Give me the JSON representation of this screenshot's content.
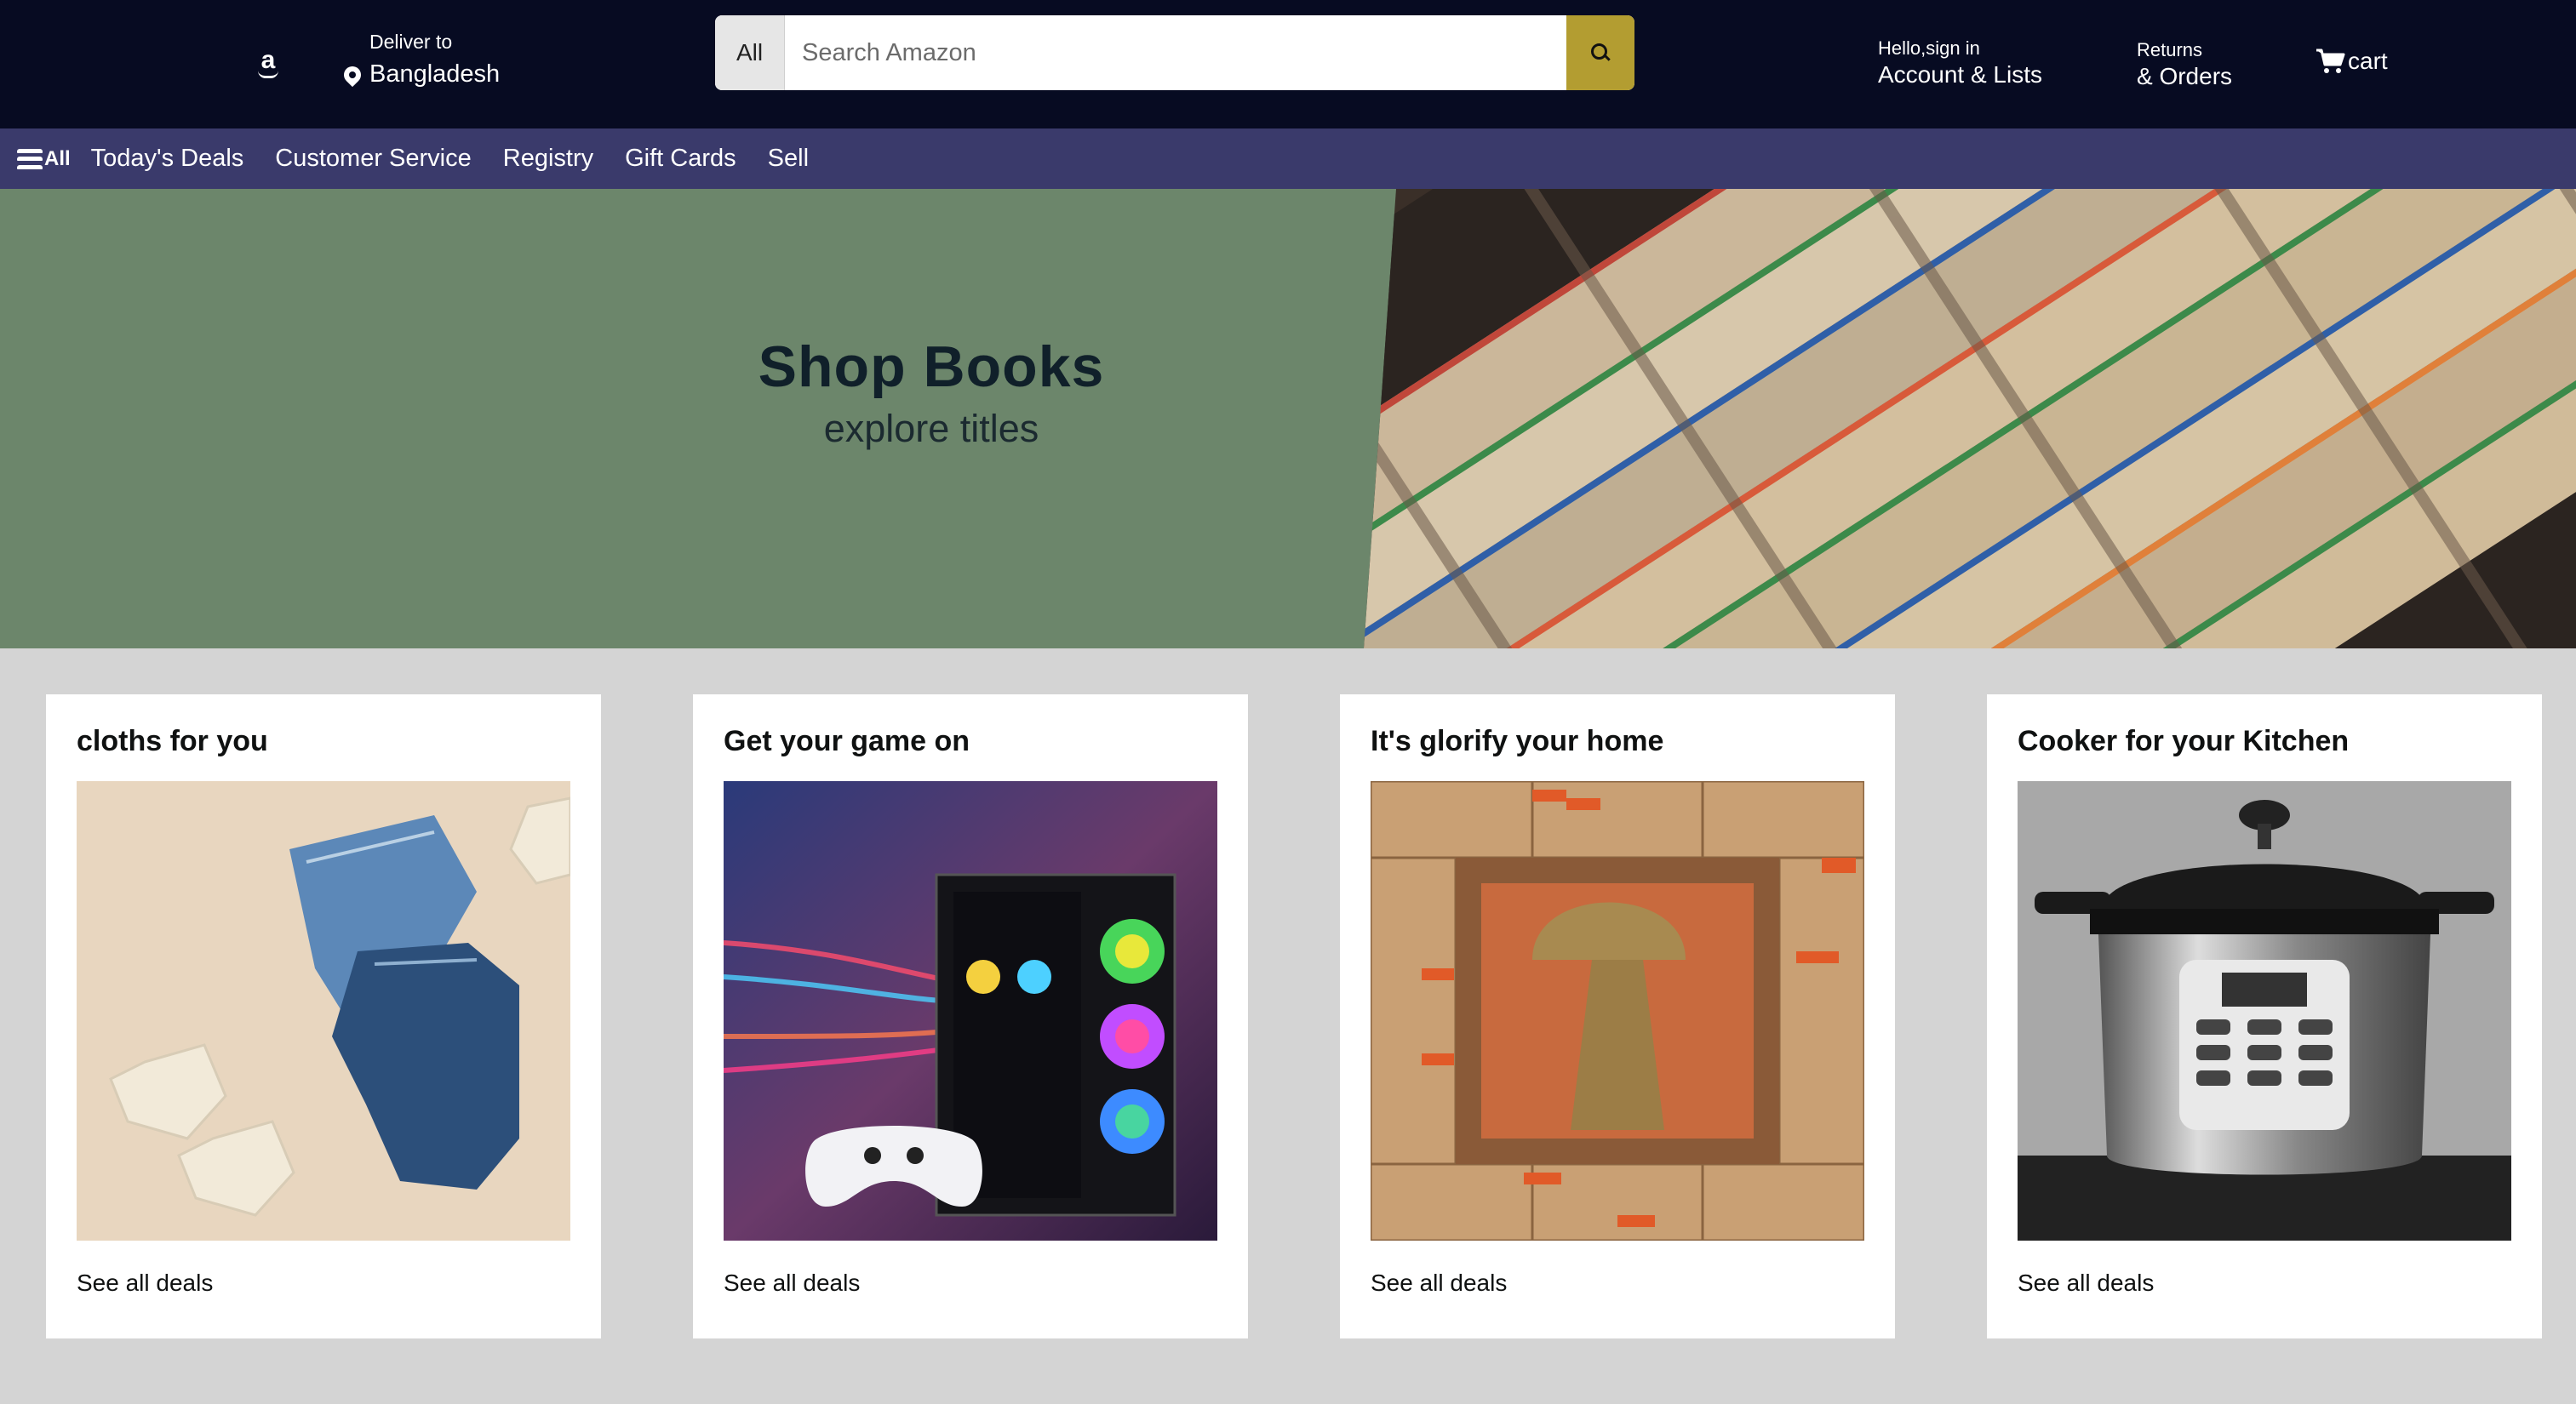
{
  "header": {
    "logo_letter": "a",
    "deliver_label": "Deliver to",
    "deliver_location": "Bangladesh",
    "search_category": "All",
    "search_placeholder": "Search Amazon",
    "account_greeting": "Hello,sign in",
    "account_label": "Account & Lists",
    "returns_label": "Returns",
    "orders_label": "& Orders",
    "cart_label": "cart",
    "icons": [
      "amazon-logo-icon",
      "location-pin-icon",
      "search-icon",
      "cart-icon",
      "menu-icon"
    ]
  },
  "nav": {
    "all_label": "All",
    "items": [
      "Today's Deals",
      "Customer Service",
      "Registry",
      "Gift Cards",
      "Sell"
    ]
  },
  "hero": {
    "title": "Shop Books",
    "subtitle": "explore titles"
  },
  "cards": [
    {
      "title": "cloths for you",
      "link": "See all deals"
    },
    {
      "title": "Get your game on",
      "link": "See all deals"
    },
    {
      "title": "It's glorify your home",
      "link": "See all deals"
    },
    {
      "title": "Cooker for your Kitchen",
      "link": "See all deals"
    }
  ],
  "colors": {
    "header_bg": "#070b22",
    "nav_bg": "#3a3a6b",
    "hero_bg": "#6c866b",
    "search_button": "#b39d31",
    "page_bg": "#d4d4d4"
  }
}
